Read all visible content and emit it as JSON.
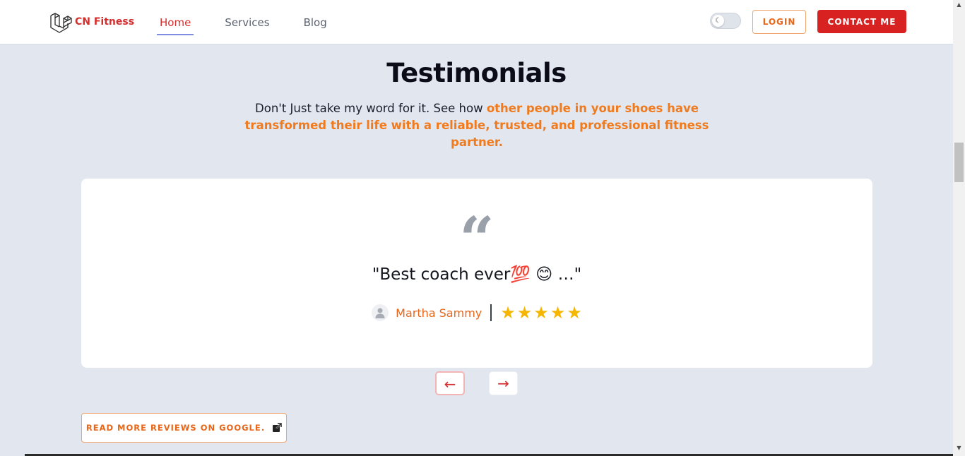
{
  "header": {
    "brand": "CN Fitness",
    "nav": [
      {
        "label": "Home",
        "active": true
      },
      {
        "label": "Services",
        "active": false
      },
      {
        "label": "Blog",
        "active": false
      }
    ],
    "theme_toggle_icon": "moon-icon",
    "login_label": "LOGIN",
    "contact_label": "CONTACT ME"
  },
  "section": {
    "title": "Testimonials",
    "subtitle_plain": "Don't Just take my word for it. See how ",
    "subtitle_highlight": "other people in your shoes have transformed their life with a reliable, trusted, and professional fitness partner."
  },
  "testimonial": {
    "quote": "\"Best coach ever💯 😊 …\"",
    "author": "Martha Sammy",
    "rating": 5,
    "stars": [
      "★",
      "★",
      "★",
      "★",
      "★"
    ]
  },
  "carousel": {
    "prev_label": "←",
    "next_label": "→"
  },
  "reviews_link_label": "READ MORE REVIEWS ON GOOGLE.",
  "colors": {
    "accent_red": "#d82121",
    "accent_orange": "#e8661a",
    "star": "#f6b600",
    "background": "#e2e7ef"
  }
}
